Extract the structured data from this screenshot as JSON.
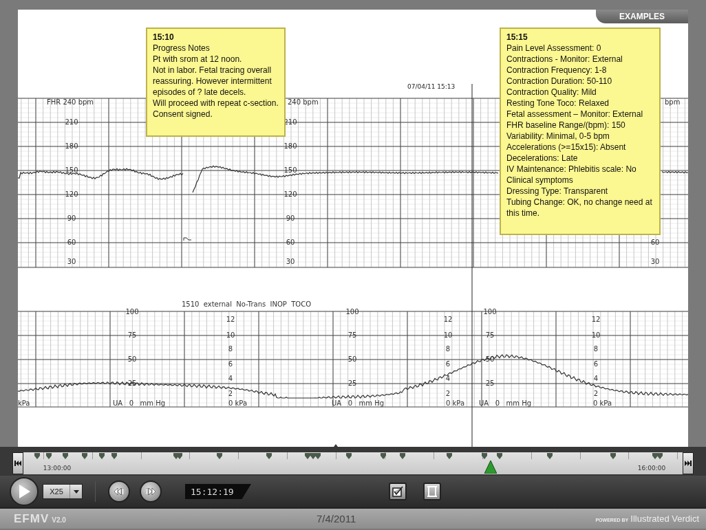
{
  "header_tab": {
    "label": "EXAMPLES"
  },
  "notes": [
    {
      "time": "15:10",
      "lines": [
        "Progress Notes",
        "Pt with srom at 12 noon.",
        "Not in labor. Fetal tracing overall reassuring. However intermittent episodes of ? late decels.",
        "Will proceed with repeat c-section.",
        "Consent signed."
      ]
    },
    {
      "time": "15:15",
      "lines": [
        "Pain Level Assessment: 0",
        "Contractions - Monitor: External",
        "Contraction Frequency: 1-8",
        "Contraction Duration: 50-110",
        "Contraction Quality: Mild",
        "Resting Tone Toco: Relaxed",
        "Fetal assessment – Monitor: External",
        "FHR baseline Range/(bpm): 150",
        "Variability: Minimal, 0-5 bpm",
        "Accelerations (>=15x15): Absent",
        "Decelerations: Late",
        "IV Maintenance: Phlebitis scale: No Clinical symptoms",
        "Dressing Type: Transparent",
        "Tubing Change: OK, no change need at this time."
      ]
    }
  ],
  "cursor": {
    "timestamp": "07/04/11 15:13"
  },
  "fhr_panel": {
    "header_labels": [
      "FHR 240 bpm",
      "240 bpm",
      "bpm"
    ],
    "scales": [
      [
        "210",
        "180",
        "150",
        "120",
        "90",
        "60",
        "30"
      ],
      [
        "210",
        "180",
        "150",
        "120",
        "90",
        "60",
        "30"
      ],
      [
        "60",
        "30"
      ]
    ]
  },
  "toco_panel": {
    "header": "1510  external  No-Trans  INOP  TOCO",
    "ua_scales": [
      [
        "100",
        "75",
        "50",
        "25"
      ],
      [
        "100",
        "75",
        "50",
        "25"
      ],
      [
        "100",
        "75",
        "50",
        "25"
      ]
    ],
    "kpa_scales": [
      [
        "12",
        "10",
        "8",
        "6",
        "4",
        "2"
      ],
      [
        "12",
        "10",
        "8",
        "6",
        "4",
        "2"
      ],
      [
        "12",
        "10",
        "8",
        "6",
        "4",
        "2"
      ]
    ],
    "footer_labels": [
      "kPa",
      "UA   0   mm Hg",
      "0 kPa",
      "UA   0   mm Hg",
      "0 kPa",
      "UA   0   mm Hg",
      "0 kPa"
    ]
  },
  "timeline": {
    "start_label": "13:00:00",
    "end_label": "16:00:00",
    "markers": [
      {
        "level": 0.021
      },
      {
        "level": 0.039
      },
      {
        "level": 0.064
      },
      {
        "level": 0.093
      },
      {
        "level": 0.119
      },
      {
        "level": 0.138
      },
      {
        "level": 0.232
      },
      {
        "level": 0.237
      },
      {
        "level": 0.297
      },
      {
        "level": 0.373
      },
      {
        "level": 0.431
      },
      {
        "level": 0.439
      },
      {
        "level": 0.447
      },
      {
        "level": 0.494
      },
      {
        "level": 0.546
      },
      {
        "level": 0.575
      },
      {
        "level": 0.646
      },
      {
        "level": 0.699
      },
      {
        "level": 0.722
      },
      {
        "level": 0.799
      },
      {
        "level": 0.895
      },
      {
        "level": 0.958
      },
      {
        "level": 0.966
      }
    ],
    "playhead": {
      "level": 0.709
    }
  },
  "controls": {
    "speed": "X25",
    "time": "15:12:19"
  },
  "footer": {
    "product": "EFMV",
    "version": "V2.0",
    "date": "7/4/2011",
    "powered_by": "POWERED BY",
    "brand": "Illustrated Verdict"
  }
}
